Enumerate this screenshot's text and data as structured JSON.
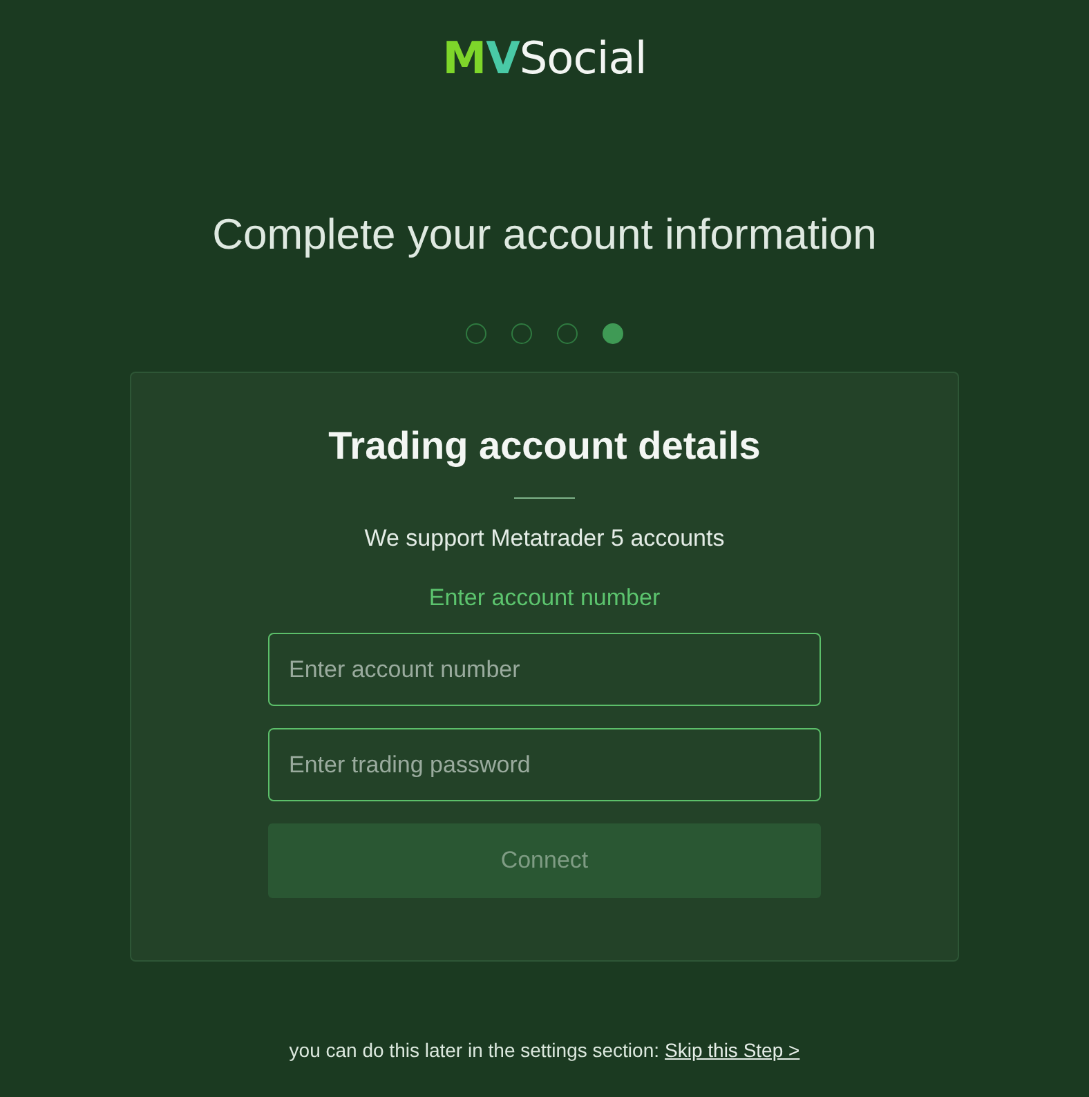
{
  "logo": {
    "mark": [
      "M",
      "V"
    ],
    "name": "Social"
  },
  "heading": "Complete your account information",
  "steps": [
    {
      "selected": false
    },
    {
      "selected": false
    },
    {
      "selected": false
    },
    {
      "selected": true
    }
  ],
  "card": {
    "title": "Trading account details",
    "subtitle": "We support Metatrader 5 accounts",
    "label": "Enter account number",
    "fields": [
      {
        "placeholder": "Enter account number"
      },
      {
        "placeholder": "Enter trading password"
      }
    ],
    "button": {
      "label": "Connect",
      "disabled": true
    }
  },
  "footer": {
    "text": "you can do this later in the settings section:",
    "link": "Skip this Step >"
  }
}
